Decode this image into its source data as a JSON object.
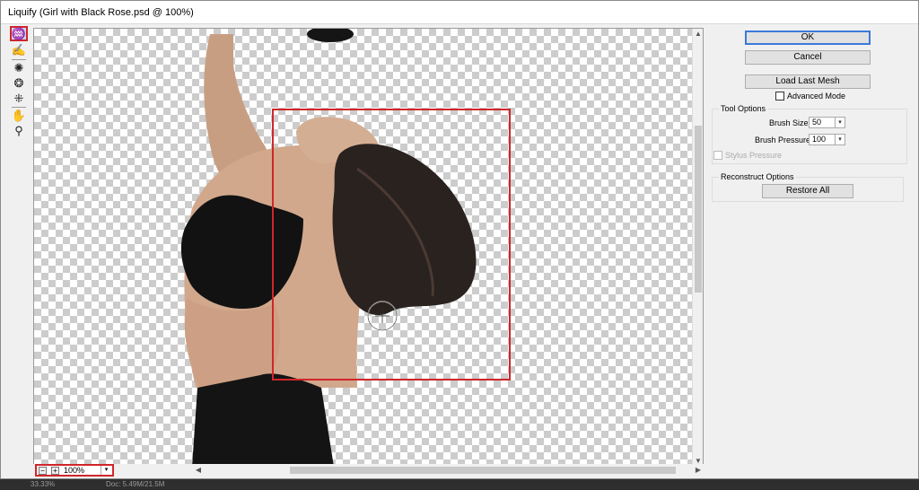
{
  "window": {
    "title": "Liquify (Girl with Black Rose.psd @ 100%)"
  },
  "tools": [
    {
      "name": "forward-warp",
      "icon": "warp-icon",
      "glyph": "♒",
      "active": true
    },
    {
      "name": "reconstruct",
      "icon": "brush-icon",
      "glyph": "✍",
      "active": false
    },
    {
      "name": "twirl",
      "icon": "twirl-icon",
      "glyph": "✺",
      "active": false
    },
    {
      "name": "pucker",
      "icon": "pucker-icon",
      "glyph": "❂",
      "active": false
    },
    {
      "name": "bloat",
      "icon": "bloat-icon",
      "glyph": "⁜",
      "active": false
    },
    {
      "name": "hand",
      "icon": "hand-icon",
      "glyph": "✋",
      "active": false
    },
    {
      "name": "zoom",
      "icon": "zoom-icon",
      "glyph": "⚲",
      "active": false
    }
  ],
  "zoom": {
    "minus": "−",
    "plus": "+",
    "value": "100%",
    "dropdown_icon": "chevron-down-icon"
  },
  "buttons": {
    "ok": "OK",
    "cancel": "Cancel",
    "load_last_mesh": "Load Last Mesh"
  },
  "advanced_mode": {
    "label": "Advanced Mode",
    "checked": false
  },
  "tool_options": {
    "title": "Tool Options",
    "brush_size_label": "Brush Size:",
    "brush_size_value": "50",
    "brush_pressure_label": "Brush Pressure:",
    "brush_pressure_value": "100",
    "stylus_pressure_label": "Stylus Pressure"
  },
  "reconstruct_options": {
    "title": "Reconstruct Options",
    "restore_all": "Restore All"
  },
  "taskbar": {
    "left_text": "33.33%",
    "doc_text": "Doc: 5.49M/21.5M"
  },
  "colors": {
    "highlight": "#d0262a",
    "accent": "#3b7ad8"
  }
}
